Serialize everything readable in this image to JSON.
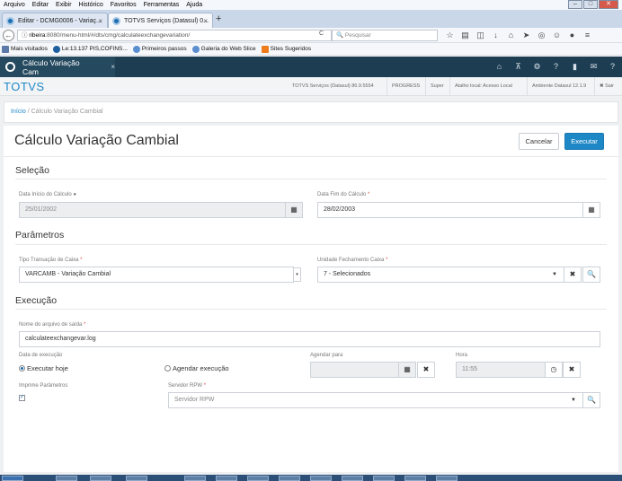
{
  "browser": {
    "menu": [
      "Arquivo",
      "Editar",
      "Exibir",
      "Histórico",
      "Favoritos",
      "Ferramentas",
      "Ajuda"
    ],
    "tabs": [
      {
        "label": "Editar - DCMG0006 - Variaç..."
      },
      {
        "label": "TOTVS Serviços (Datasul) 0..."
      }
    ],
    "url": {
      "host": "ribeira",
      "rest": ":8080/menu-html/#/dts/cmg/calculateexchangevariation/"
    },
    "search_placeholder": "Pesquisar",
    "bookmarks": [
      "Mais visitados",
      "Le:13.137 PIS,COFINS...",
      "Primeiros passos",
      "Galeria do Web Slice",
      "Sites Sugeridos"
    ]
  },
  "app": {
    "tab_label": "Cálculo Variação Cam",
    "brand": "TOTVS",
    "header_info": [
      "TOTVS Serviços (Datasul) 86.9.5554",
      "PROGRESS",
      "Super",
      "Atalho local: Acesso Local",
      "Ambiente Datasul 12.1.9",
      "Sair"
    ]
  },
  "breadcrumb": {
    "home": "Início",
    "separator": "/",
    "current": "Cálculo Variação Cambial"
  },
  "page": {
    "title": "Cálculo Variação Cambial",
    "cancel_label": "Cancelar",
    "execute_label": "Executar"
  },
  "selecao": {
    "title": "Seleção",
    "data_inicio_label": "Data Início do Cálculo",
    "data_inicio_value": "25/01/2002",
    "data_fim_label": "Data Fim do Cálculo",
    "data_fim_value": "28/02/2003"
  },
  "parametros": {
    "title": "Parâmetros",
    "tipo_label": "Tipo Transação de Caixa",
    "tipo_value": "VARCAMB - Variação Cambial",
    "unidade_label": "Unidade Fechamento Caixa",
    "unidade_value": "7 - Selecionados"
  },
  "execucao": {
    "title": "Execução",
    "arquivo_label": "Nome do arquivo de saída",
    "arquivo_value": "calculateexchangevar.log",
    "data_exec_label": "Data de execução",
    "opt_hoje": "Executar hoje",
    "opt_agendar": "Agendar execução",
    "agendar_label": "Agendar para",
    "agendar_value": "",
    "hora_label": "Hora",
    "hora_value": "11:55",
    "imprime_label": "Imprime Parâmetros",
    "imprime_checked": true,
    "servidor_label": "Servidor RPW",
    "servidor_placeholder": "Servidor RPW"
  },
  "colors": {
    "accent": "#1e88c7",
    "app_bar": "#1d3d53",
    "required": "#d9534f"
  }
}
